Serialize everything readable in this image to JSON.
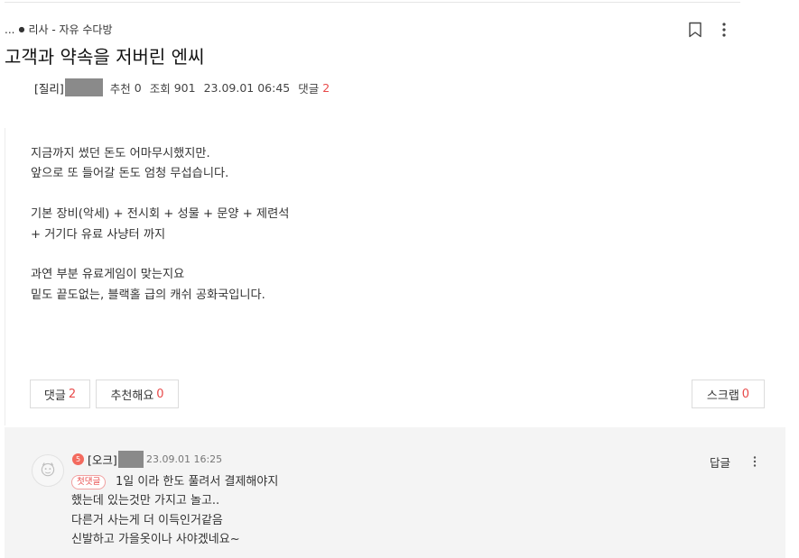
{
  "breadcrumb": {
    "ellipsis": "...",
    "dot": "●",
    "board": "리사 - 자유 수다방"
  },
  "post": {
    "title": "고객과 약속을 저버린 엔씨",
    "author": "[질리]",
    "recommend_label": "추천",
    "recommend_count": "0",
    "views_label": "조회",
    "views_count": "901",
    "datetime": "23.09.01 06:45",
    "comments_label": "댓글",
    "comments_count": "2",
    "body_lines": [
      "지금까지 썼던 돈도 어마무시했지만.",
      "앞으로 또 들어갈 돈도 엄청 무섭습니다.",
      "기본 장비(악세) + 전시회 + 성물 + 문양 + 제련석",
      "+ 거기다 유료 사냥터 까지",
      "과연 부분 유료게임이 맞는지요",
      "밑도 끝도없는, 블랙홀 급의 캐쉬 공화국입니다."
    ]
  },
  "actions": {
    "comment_label": "댓글",
    "comment_count": "2",
    "recommend_label": "추천해요",
    "recommend_count": "0",
    "scrap_label": "스크랩",
    "scrap_count": "0"
  },
  "comment": {
    "level": "5",
    "author": "[오크]",
    "datetime": "23.09.01 16:25",
    "reply_label": "답글",
    "badge": "첫댓글",
    "lines": [
      "1일 이라 한도 풀려서 결제해야지",
      "했는데 있는것만 가지고 놀고..",
      "다른거 사는게 더 이득인거같음",
      "신발하고 가을옷이나 사야겠네요~"
    ]
  },
  "icons": {
    "bookmark": "bookmark-icon",
    "more": "more-vertical-icon",
    "avatar": "default-avatar-icon"
  },
  "colors": {
    "accent": "#e84a4a",
    "level_badge": "#f36a5e",
    "comment_bg": "#f4f4f4",
    "mask": "#8a8a8a"
  }
}
